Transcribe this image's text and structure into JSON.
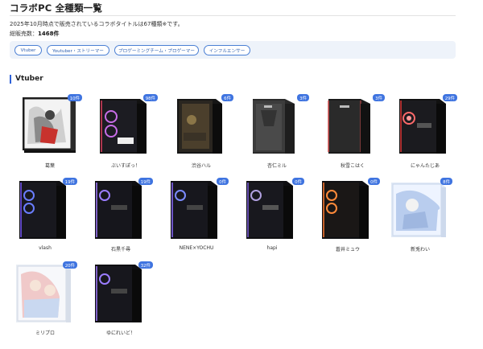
{
  "header": {
    "title": "コラボPC 全種類一覧",
    "intro": "2025年10月時点で販売されているコラボタイトルは67種類※です。",
    "sales_label": "総販売数：",
    "sales_value": "1468件"
  },
  "filters": [
    {
      "label": "Vtuber"
    },
    {
      "label": "Youtuber・ストリーマー"
    },
    {
      "label": "プロゲーミングチーム・プロゲーマー"
    },
    {
      "label": "インフルエンサー"
    }
  ],
  "section": {
    "title": "Vtuber"
  },
  "colors": {
    "accent": "#3f74e0",
    "chip_border": "#4a7fd4",
    "filter_bg": "#eef3fa"
  },
  "products": [
    {
      "name": "葛葉",
      "count": "10件"
    },
    {
      "name": "ぶいすぽっ！",
      "count": "98件"
    },
    {
      "name": "渋谷ハル",
      "count": "6件"
    },
    {
      "name": "杏仁ミル",
      "count": "3件"
    },
    {
      "name": "秋雪こはく",
      "count": "3件"
    },
    {
      "name": "にゃんたじあ",
      "count": "29件"
    },
    {
      "name": "vlash",
      "count": "19件"
    },
    {
      "name": "石黒千尋",
      "count": "19件"
    },
    {
      "name": "NENE×YOCHU",
      "count": "0件"
    },
    {
      "name": "hapi",
      "count": "0件"
    },
    {
      "name": "蒼井ミュウ",
      "count": "0件"
    },
    {
      "name": "新兎わい",
      "count": "8件"
    },
    {
      "name": "ミリプロ",
      "count": "20件"
    },
    {
      "name": "ゆにれいど！",
      "count": "32件"
    }
  ]
}
